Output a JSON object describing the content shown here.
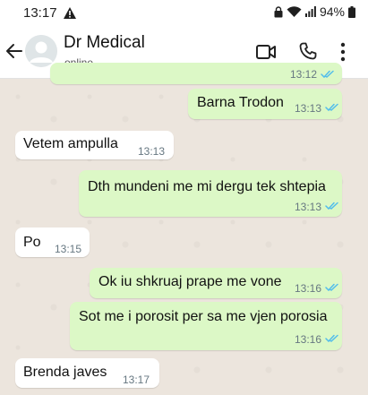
{
  "status_bar": {
    "time": "13:17",
    "battery": "94%"
  },
  "header": {
    "contact_name": "Dr Medical",
    "contact_status": "online"
  },
  "icons": {
    "back": "arrow-left-icon",
    "avatar": "avatar-placeholder-icon",
    "video": "video-camera-icon",
    "call": "phone-icon",
    "menu": "kebab-menu-icon",
    "read": "double-check-icon"
  },
  "colors": {
    "outgoing_bubble": "#dcf8c6",
    "incoming_bubble": "#ffffff",
    "chat_background": "#ece5dd",
    "read_ticks": "#53bdeb"
  },
  "messages": [
    {
      "direction": "outgoing",
      "text": "",
      "time": "13:12",
      "status": "read"
    },
    {
      "direction": "outgoing",
      "text": "Barna Trodon",
      "time": "13:13",
      "status": "read"
    },
    {
      "direction": "incoming",
      "text": "Vetem ampulla",
      "time": "13:13"
    },
    {
      "direction": "outgoing",
      "text": "Dth mundeni me mi dergu tek shtepia",
      "time": "13:13",
      "status": "read"
    },
    {
      "direction": "incoming",
      "text": "Po",
      "time": "13:15"
    },
    {
      "direction": "outgoing",
      "text": "Ok iu shkruaj prape me vone",
      "time": "13:16",
      "status": "read"
    },
    {
      "direction": "outgoing",
      "text": "Sot me i porosit per sa me vjen porosia",
      "time": "13:16",
      "status": "read"
    },
    {
      "direction": "incoming",
      "text": "Brenda javes",
      "time": "13:17"
    }
  ]
}
